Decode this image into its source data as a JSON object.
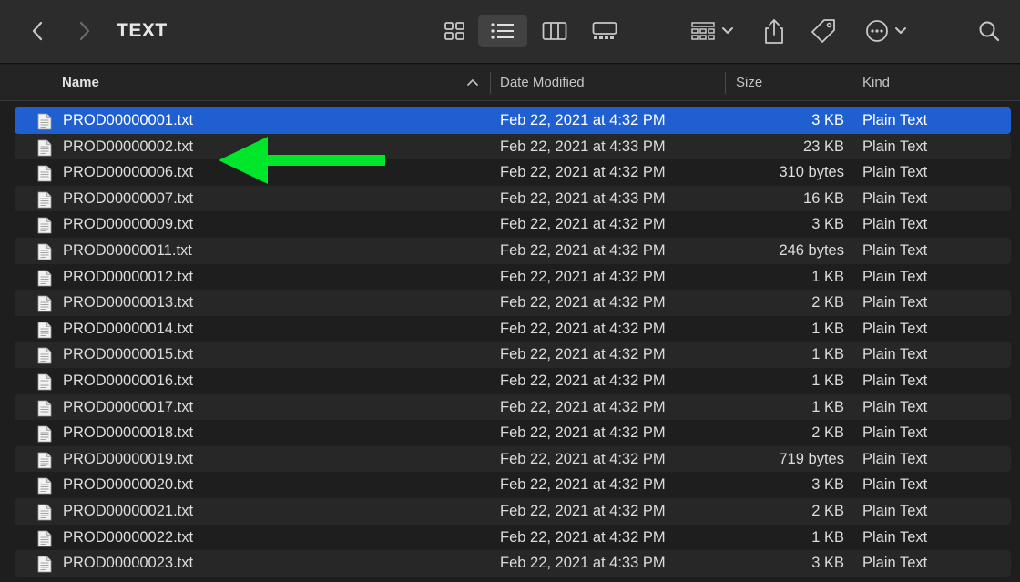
{
  "window": {
    "title": "TEXT"
  },
  "toolbar": {
    "back_icon": "chevron-left-icon",
    "forward_icon": "chevron-right-icon",
    "view_modes": [
      "icon-view",
      "list-view",
      "column-view",
      "gallery-view"
    ],
    "active_view": "list-view"
  },
  "columns": {
    "name": "Name",
    "date": "Date Modified",
    "size": "Size",
    "kind": "Kind"
  },
  "files": [
    {
      "name": "PROD00000001.txt",
      "date": "Feb 22, 2021 at 4:32 PM",
      "size": "3 KB",
      "kind": "Plain Text",
      "selected": true
    },
    {
      "name": "PROD00000002.txt",
      "date": "Feb 22, 2021 at 4:33 PM",
      "size": "23 KB",
      "kind": "Plain Text"
    },
    {
      "name": "PROD00000006.txt",
      "date": "Feb 22, 2021 at 4:32 PM",
      "size": "310 bytes",
      "kind": "Plain Text"
    },
    {
      "name": "PROD00000007.txt",
      "date": "Feb 22, 2021 at 4:33 PM",
      "size": "16 KB",
      "kind": "Plain Text"
    },
    {
      "name": "PROD00000009.txt",
      "date": "Feb 22, 2021 at 4:32 PM",
      "size": "3 KB",
      "kind": "Plain Text"
    },
    {
      "name": "PROD00000011.txt",
      "date": "Feb 22, 2021 at 4:32 PM",
      "size": "246 bytes",
      "kind": "Plain Text"
    },
    {
      "name": "PROD00000012.txt",
      "date": "Feb 22, 2021 at 4:32 PM",
      "size": "1 KB",
      "kind": "Plain Text"
    },
    {
      "name": "PROD00000013.txt",
      "date": "Feb 22, 2021 at 4:32 PM",
      "size": "2 KB",
      "kind": "Plain Text"
    },
    {
      "name": "PROD00000014.txt",
      "date": "Feb 22, 2021 at 4:32 PM",
      "size": "1 KB",
      "kind": "Plain Text"
    },
    {
      "name": "PROD00000015.txt",
      "date": "Feb 22, 2021 at 4:32 PM",
      "size": "1 KB",
      "kind": "Plain Text"
    },
    {
      "name": "PROD00000016.txt",
      "date": "Feb 22, 2021 at 4:32 PM",
      "size": "1 KB",
      "kind": "Plain Text"
    },
    {
      "name": "PROD00000017.txt",
      "date": "Feb 22, 2021 at 4:32 PM",
      "size": "1 KB",
      "kind": "Plain Text"
    },
    {
      "name": "PROD00000018.txt",
      "date": "Feb 22, 2021 at 4:32 PM",
      "size": "2 KB",
      "kind": "Plain Text"
    },
    {
      "name": "PROD00000019.txt",
      "date": "Feb 22, 2021 at 4:32 PM",
      "size": "719 bytes",
      "kind": "Plain Text"
    },
    {
      "name": "PROD00000020.txt",
      "date": "Feb 22, 2021 at 4:32 PM",
      "size": "3 KB",
      "kind": "Plain Text"
    },
    {
      "name": "PROD00000021.txt",
      "date": "Feb 22, 2021 at 4:32 PM",
      "size": "2 KB",
      "kind": "Plain Text"
    },
    {
      "name": "PROD00000022.txt",
      "date": "Feb 22, 2021 at 4:32 PM",
      "size": "1 KB",
      "kind": "Plain Text"
    },
    {
      "name": "PROD00000023.txt",
      "date": "Feb 22, 2021 at 4:33 PM",
      "size": "3 KB",
      "kind": "Plain Text"
    }
  ],
  "annotation": {
    "icon": "arrow-left-icon",
    "color": "#00e62a"
  },
  "colors": {
    "selection": "#1f5fcf",
    "background": "#1e1e1e",
    "toolbar": "#2c2c2c"
  }
}
